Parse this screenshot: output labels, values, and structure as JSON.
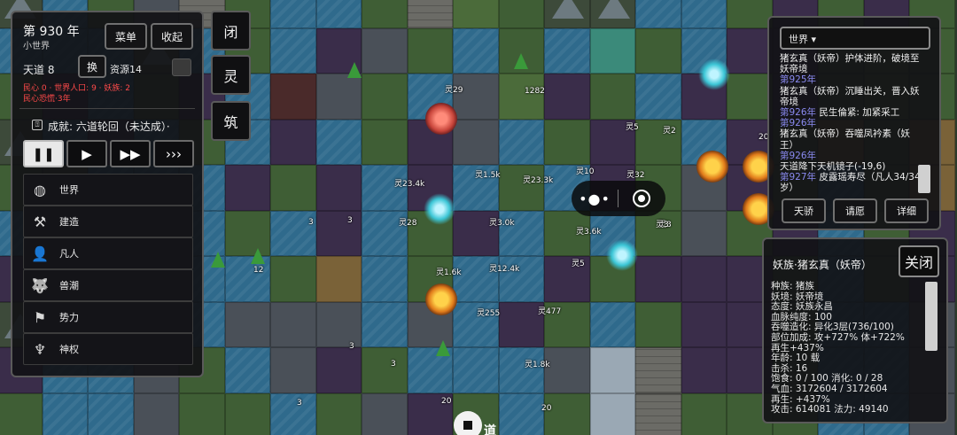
{
  "top": {
    "year": "第 930 年",
    "world": "小世界",
    "menu": "菜单",
    "collapse": "收起",
    "tiandao": "天道 8",
    "swap": "换",
    "resource": "资源14",
    "stat_line1": "民心 0 · 世界人口: 9 · 妖族: 2",
    "stat_line2": "民心恐慌·3年",
    "achievement_icon": "⍐",
    "achievement": "成就: 六道轮回（未达成）·"
  },
  "speed": {
    "pause": "❚❚",
    "play": "▶",
    "fast": "▶▶",
    "fastest": "›››"
  },
  "tools": [
    {
      "icon": "globe-icon",
      "glyph": "◍",
      "label": "世界"
    },
    {
      "icon": "hammer-icon",
      "glyph": "⚒",
      "label": "建造"
    },
    {
      "icon": "person-icon",
      "glyph": "👤",
      "label": "凡人"
    },
    {
      "icon": "wolf-icon",
      "glyph": "🐺",
      "label": "兽潮"
    },
    {
      "icon": "banner-icon",
      "glyph": "⚑",
      "label": "势力"
    },
    {
      "icon": "trident-icon",
      "glyph": "♆",
      "label": "神权"
    }
  ],
  "vertical_buttons": [
    "闭",
    "灵",
    "筑"
  ],
  "map_labels": [
    "灵29",
    "1282",
    "灵5",
    "灵2",
    "20",
    "灵10",
    "灵32",
    "灵3",
    "灵23.4k",
    "灵1.5k",
    "灵23.3k",
    "灵3.0k",
    "灵28",
    "灵3.6k",
    "灵3",
    "3",
    "3",
    "12",
    "灵1.6k",
    "灵12.4k",
    "灵5",
    "灵255",
    "灵477",
    "3",
    "灵1.8k",
    "3",
    "20",
    "20",
    "3"
  ],
  "log": {
    "select": "世界 ▾",
    "lines": [
      {
        "type": "text",
        "text": "猪玄真（妖帝）护体进阶，破境至妖帝境"
      },
      {
        "type": "year",
        "text": "第925年"
      },
      {
        "type": "text",
        "text": "猪玄真（妖帝）沉睡出关，晋入妖帝境"
      },
      {
        "type": "mixed",
        "year": "第926年",
        "text": " 民生倫紧: 加紧采工"
      },
      {
        "type": "year",
        "text": "第926年"
      },
      {
        "type": "text",
        "text": "猪玄真（妖帝）吞噬凤衿素（妖王）"
      },
      {
        "type": "year",
        "text": "第926年"
      },
      {
        "type": "text",
        "text": "天道降下天机镜子(-19,6)"
      },
      {
        "type": "mixed",
        "year": "第927年",
        "text": " 皮露瑶寿尽（凡人34/34岁）"
      }
    ],
    "buttons": [
      "天骄",
      "请愿",
      "详细"
    ]
  },
  "character": {
    "name": "妖族·猪玄真（妖帝）",
    "close": "关闭",
    "stats": [
      "种族: 猪族",
      "妖境: 妖帝境",
      "态度: 妖族永昌",
      "血脉纯度: 100",
      "吞噬造化: 异化3层(736/100)",
      "部位加成: 攻+727% 体+722%",
      "再生+437%",
      "年龄: 10 载",
      "击杀: 16",
      "饱食: 0 / 100  消化: 0 / 28",
      "气血: 3172604 / 3172604",
      "再生: +437%",
      "攻击: 614081  法力: 49140"
    ]
  },
  "bottom": {
    "label": "道"
  }
}
